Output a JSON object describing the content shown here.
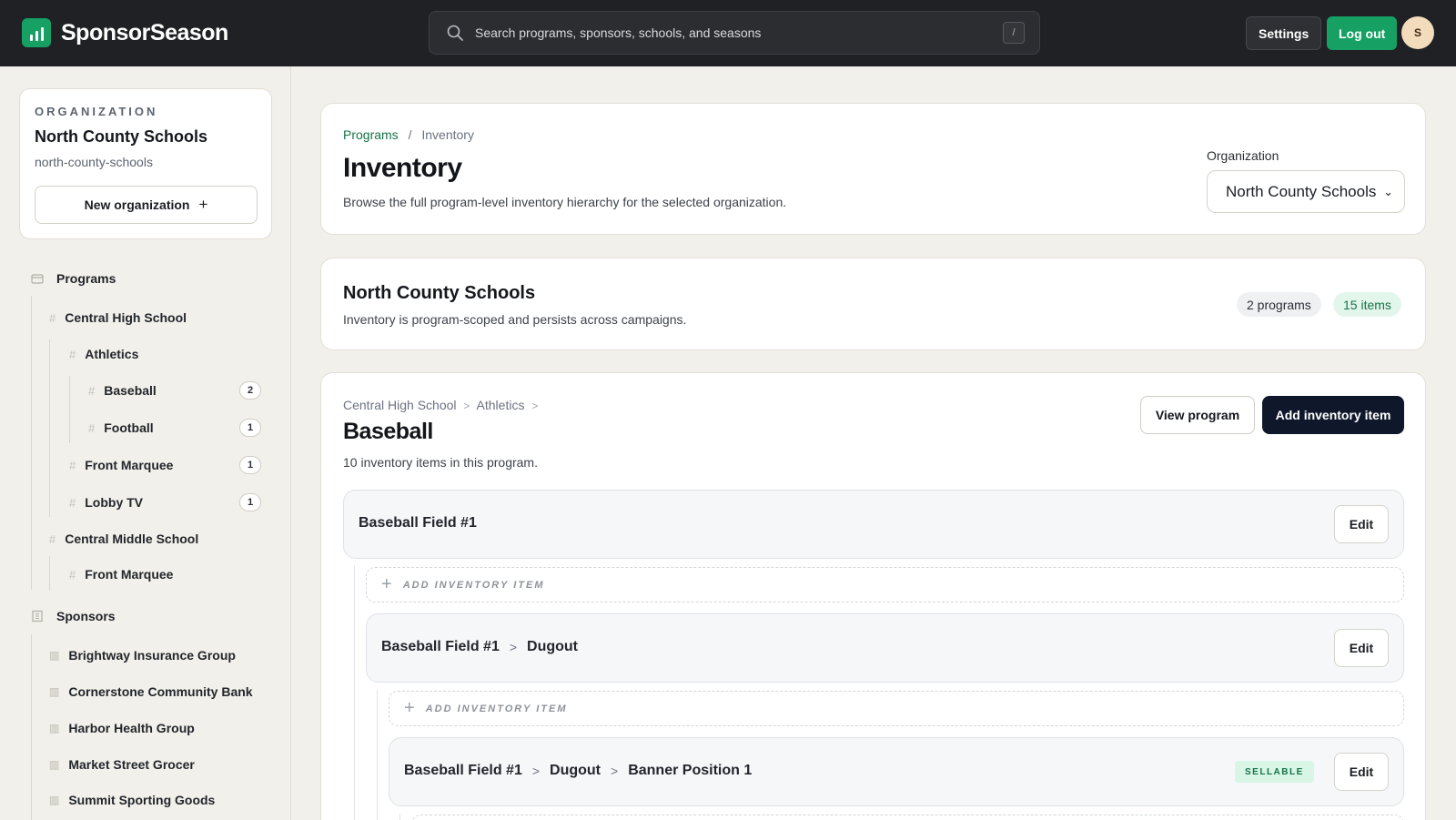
{
  "brand": {
    "name": "SponsorSeason"
  },
  "search": {
    "placeholder": "Search programs, sponsors, schools, and seasons",
    "shortcut": "/"
  },
  "header": {
    "settings": "Settings",
    "logout": "Log out",
    "avatar_initial": "S"
  },
  "org_card": {
    "eyebrow": "ORGANIZATION",
    "name": "North County Schools",
    "slug": "north-county-schools",
    "new_button": "New organization"
  },
  "sidebar": {
    "programs_label": "Programs",
    "programs": [
      {
        "label": "Central High School"
      },
      {
        "label": "Athletics"
      },
      {
        "label": "Baseball",
        "count": "2"
      },
      {
        "label": "Football",
        "count": "1"
      },
      {
        "label": "Front Marquee",
        "count": "1"
      },
      {
        "label": "Lobby TV",
        "count": "1"
      },
      {
        "label": "Central Middle School"
      },
      {
        "label": "Front Marquee"
      }
    ],
    "sponsors_label": "Sponsors",
    "sponsors": [
      {
        "label": "Brightway Insurance Group"
      },
      {
        "label": "Cornerstone Community Bank"
      },
      {
        "label": "Harbor Health Group"
      },
      {
        "label": "Market Street Grocer"
      },
      {
        "label": "Summit Sporting Goods"
      }
    ]
  },
  "page": {
    "breadcrumb": {
      "link": "Programs",
      "sep": "/",
      "current": "Inventory"
    },
    "title": "Inventory",
    "subtitle": "Browse the full program-level inventory hierarchy for the selected organization.",
    "org_select_label": "Organization",
    "org_select_value": "North County Schools"
  },
  "summary": {
    "name": "North County Schools",
    "description": "Inventory is program-scoped and persists across campaigns.",
    "programs_badge": "2 programs",
    "items_badge": "15 items"
  },
  "program": {
    "path": [
      "Central High School",
      "Athletics"
    ],
    "path_sep": ">",
    "title": "Baseball",
    "count_text": "10 inventory items in this program.",
    "view_button": "View program",
    "add_button": "Add inventory item"
  },
  "tree": {
    "add_label": "ADD INVENTORY ITEM",
    "edit_label": "Edit",
    "sellable_label": "SELLABLE",
    "sep": ">",
    "nodes": [
      {
        "parts": [
          "Baseball Field #1"
        ]
      },
      {
        "parts": [
          "Baseball Field #1",
          "Dugout"
        ]
      },
      {
        "parts": [
          "Baseball Field #1",
          "Dugout",
          "Banner Position 1"
        ],
        "sellable": true
      }
    ]
  }
}
